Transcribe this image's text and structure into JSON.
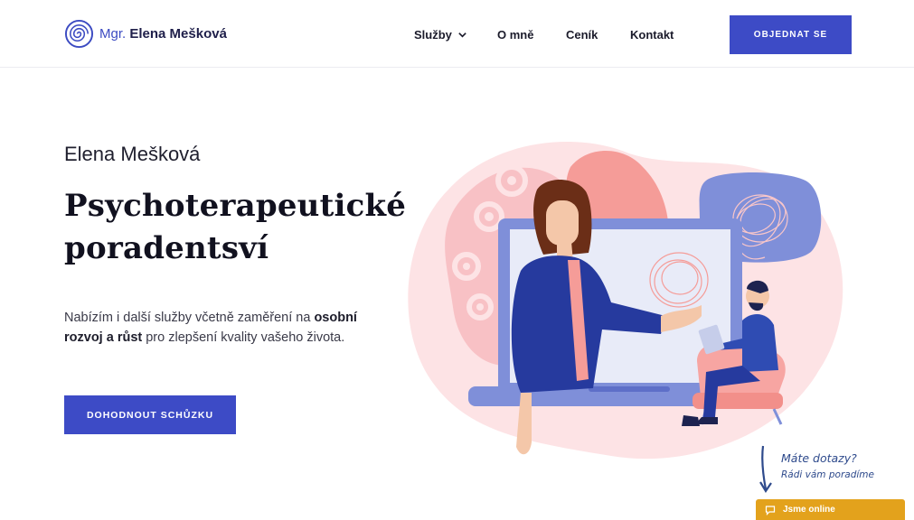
{
  "header": {
    "logo_prefix": "Mgr.",
    "logo_name": "Elena Mešková",
    "nav": [
      {
        "label": "Služby"
      },
      {
        "label": "O mně"
      },
      {
        "label": "Ceník"
      },
      {
        "label": "Kontakt"
      }
    ],
    "cta_label": "OBJEDNAT SE"
  },
  "hero": {
    "subtitle": "Elena Mešková",
    "title": "Psychoterapeutické poradentsví",
    "intro_part1": "Nabízím i další služby včetně zaměření na ",
    "intro_bold": "osobní rozvoj a růst",
    "intro_part2": " pro zlepšení kvality vašeho života.",
    "cta_label": "DOHODNOUT SCHŮZKU"
  },
  "help": {
    "line1": "Máte dotazy?",
    "line2": "Rádi vám poradíme"
  },
  "chat": {
    "label": "Jsme online"
  },
  "colors": {
    "accent": "#3d4bc6",
    "chat": "#e3a21c",
    "pink": "#f9c6c9",
    "salmon": "#f59c98",
    "lavender": "#7f8fd9"
  },
  "icons": {
    "logo": "spiral-logo-icon",
    "dropdown": "chevron-down-icon",
    "chat": "chat-bubble-icon",
    "help_arrow": "curved-arrow-down-icon"
  }
}
